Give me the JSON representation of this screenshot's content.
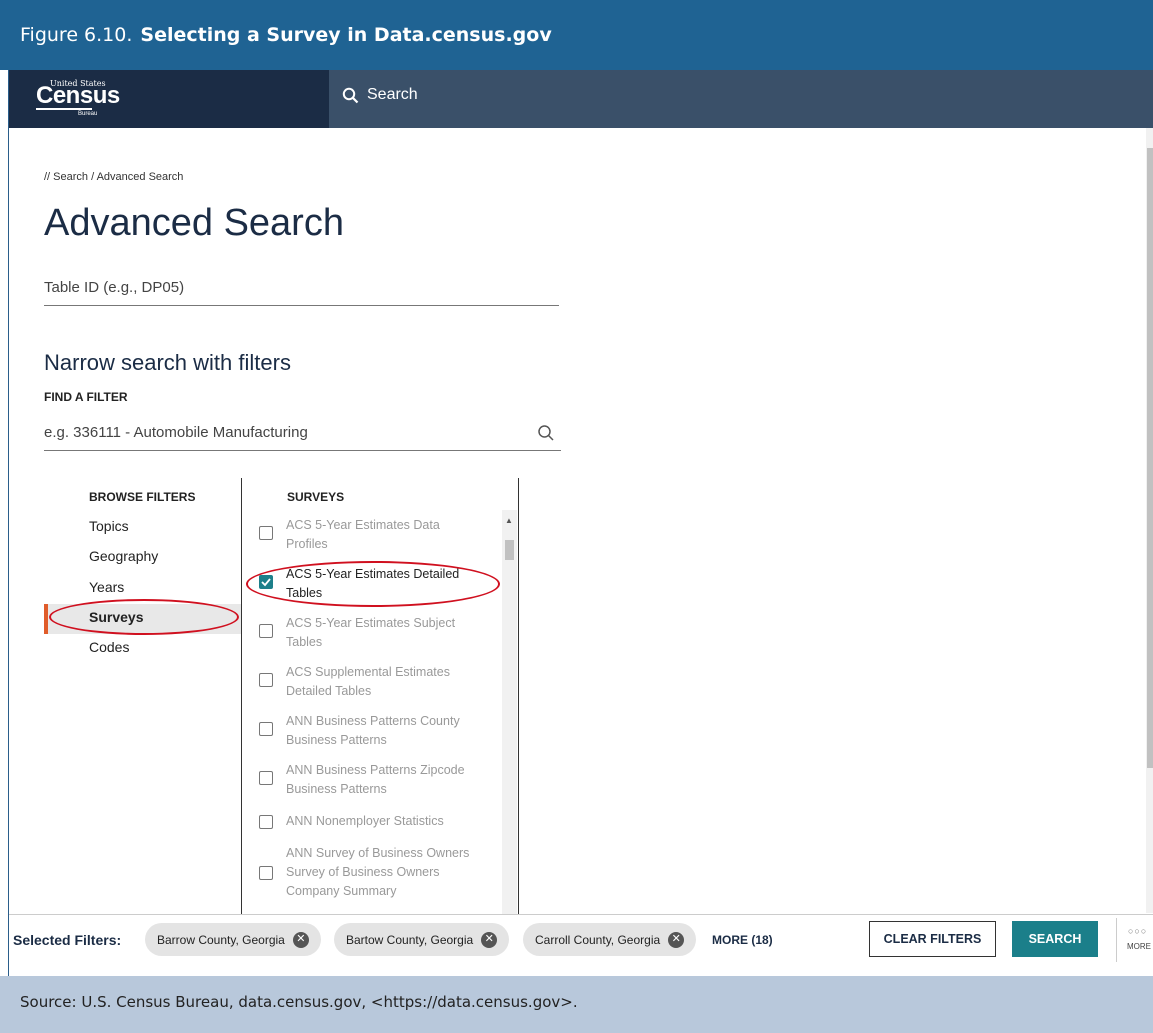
{
  "figure": {
    "label": "Figure 6.10.",
    "title": "Selecting a Survey in Data.census.gov"
  },
  "header": {
    "logo_top": "United States",
    "logo_main": "Census",
    "logo_bottom": "Bureau",
    "search_label": "Search"
  },
  "breadcrumb": "// Search / Advanced Search",
  "page_title": "Advanced Search",
  "table_id_placeholder": "Table ID (e.g., DP05)",
  "narrow_heading": "Narrow search with filters",
  "find_filter_label": "FIND A FILTER",
  "find_filter_placeholder": "e.g. 336111 - Automobile Manufacturing",
  "browse": {
    "heading": "BROWSE FILTERS",
    "items": [
      "Topics",
      "Geography",
      "Years",
      "Surveys",
      "Codes"
    ],
    "active": "Surveys"
  },
  "surveys": {
    "heading": "SURVEYS",
    "items": [
      {
        "label": "ACS 5-Year Estimates Data Profiles",
        "checked": false
      },
      {
        "label": "ACS 5-Year Estimates Detailed Tables",
        "checked": true
      },
      {
        "label": "ACS 5-Year Estimates Subject Tables",
        "checked": false
      },
      {
        "label": "ACS Supplemental Estimates Detailed Tables",
        "checked": false
      },
      {
        "label": "ANN Business Patterns County Business Patterns",
        "checked": false
      },
      {
        "label": "ANN Business Patterns Zipcode Business Patterns",
        "checked": false
      },
      {
        "label": "ANN Nonemployer Statistics",
        "checked": false
      },
      {
        "label": "ANN Survey of Business Owners Survey of Business Owners Company Summary",
        "checked": false
      }
    ]
  },
  "bottom_bar": {
    "selected_label": "Selected Filters:",
    "chips": [
      "Barrow County, Georgia",
      "Bartow County, Georgia",
      "Carroll County, Georgia"
    ],
    "more": "MORE (18)",
    "clear": "CLEAR FILTERS",
    "search": "SEARCH",
    "more_menu": "MORE"
  },
  "source": "Source: U.S. Census Bureau, data.census.gov, <https://data.census.gov>.",
  "colors": {
    "figure_bar": "#1f6393",
    "nav_dark": "#1b2c45",
    "nav": "#3a5069",
    "accent": "#1b7f8a",
    "highlight_oval": "#d0101f",
    "source_bg": "#b8c8db"
  }
}
